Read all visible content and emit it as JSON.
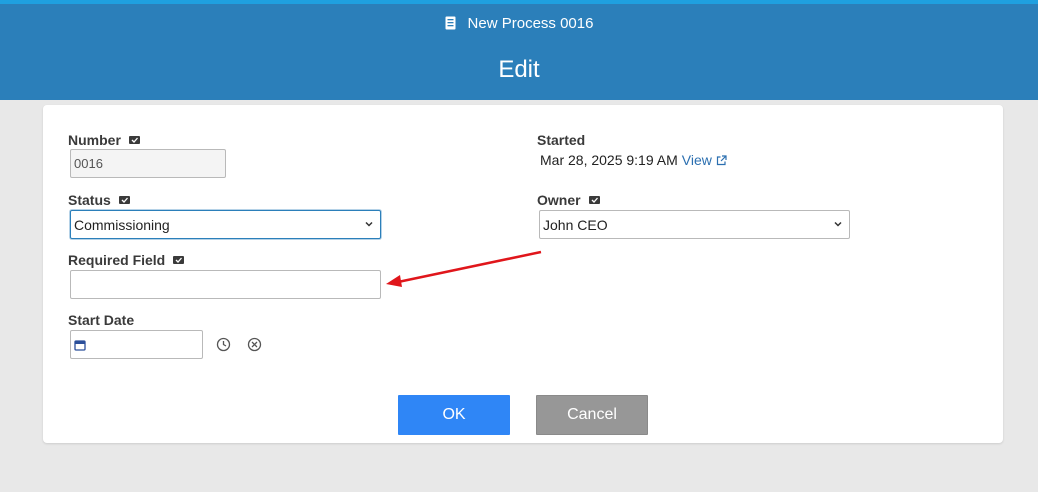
{
  "header": {
    "process_title": "New Process 0016",
    "page_title": "Edit",
    "doc_icon": "document-icon"
  },
  "form": {
    "number": {
      "label": "Number",
      "value": "0016"
    },
    "status": {
      "label": "Status",
      "value": "Commissioning"
    },
    "required_field": {
      "label": "Required Field",
      "value": ""
    },
    "start_date": {
      "label": "Start Date",
      "value": ""
    },
    "started": {
      "label": "Started",
      "value": "Mar 28, 2025 9:19 AM",
      "link": "View"
    },
    "owner": {
      "label": "Owner",
      "value": "John CEO"
    }
  },
  "actions": {
    "ok_label": "OK",
    "cancel_label": "Cancel"
  },
  "colors": {
    "header": "#2b7fba",
    "accent": "#2f86f6",
    "annotation_arrow": "#e0161b"
  }
}
